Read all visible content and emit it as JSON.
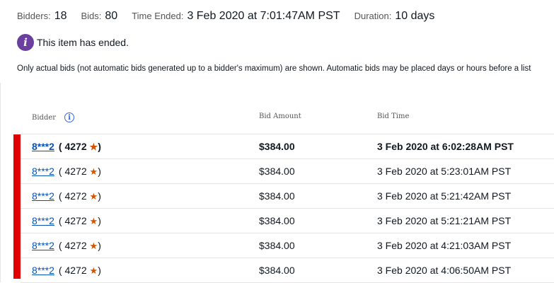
{
  "stats": {
    "bidders_label": "Bidders:",
    "bidders_value": "18",
    "bids_label": "Bids:",
    "bids_value": "80",
    "time_ended_label": "Time Ended:",
    "time_ended_value": "3 Feb 2020 at 7:01:47AM PST",
    "duration_label": "Duration:",
    "duration_value": "10 days"
  },
  "notice": {
    "icon": "info-icon",
    "text": "This item has ended."
  },
  "note": "Only actual bids (not automatic bids generated up to a bidder's maximum) are shown. Automatic bids may be placed days or hours before a list",
  "table": {
    "headers": {
      "bidder": "Bidder",
      "amount": "Bid Amount",
      "time": "Bid Time"
    },
    "rows": [
      {
        "bidder": "8***2",
        "score": "4272",
        "amount": "$384.00",
        "time": "3 Feb 2020 at 6:02:28AM PST"
      },
      {
        "bidder": "8***2",
        "score": "4272",
        "amount": "$384.00",
        "time": "3 Feb 2020 at 5:23:01AM PST"
      },
      {
        "bidder": "8***2",
        "score": "4272",
        "amount": "$384.00",
        "time": "3 Feb 2020 at 5:21:42AM PST"
      },
      {
        "bidder": "8***2",
        "score": "4272",
        "amount": "$384.00",
        "time": "3 Feb 2020 at 5:21:21AM PST"
      },
      {
        "bidder": "8***2",
        "score": "4272",
        "amount": "$384.00",
        "time": "3 Feb 2020 at 4:21:03AM PST"
      },
      {
        "bidder": "8***2",
        "score": "4272",
        "amount": "$384.00",
        "time": "3 Feb 2020 at 4:06:50AM PST"
      }
    ]
  },
  "colors": {
    "highlight_bar": "#e00000",
    "link": "#0654ba",
    "info_badge": "#6b3fa0",
    "star": "#d35400"
  }
}
